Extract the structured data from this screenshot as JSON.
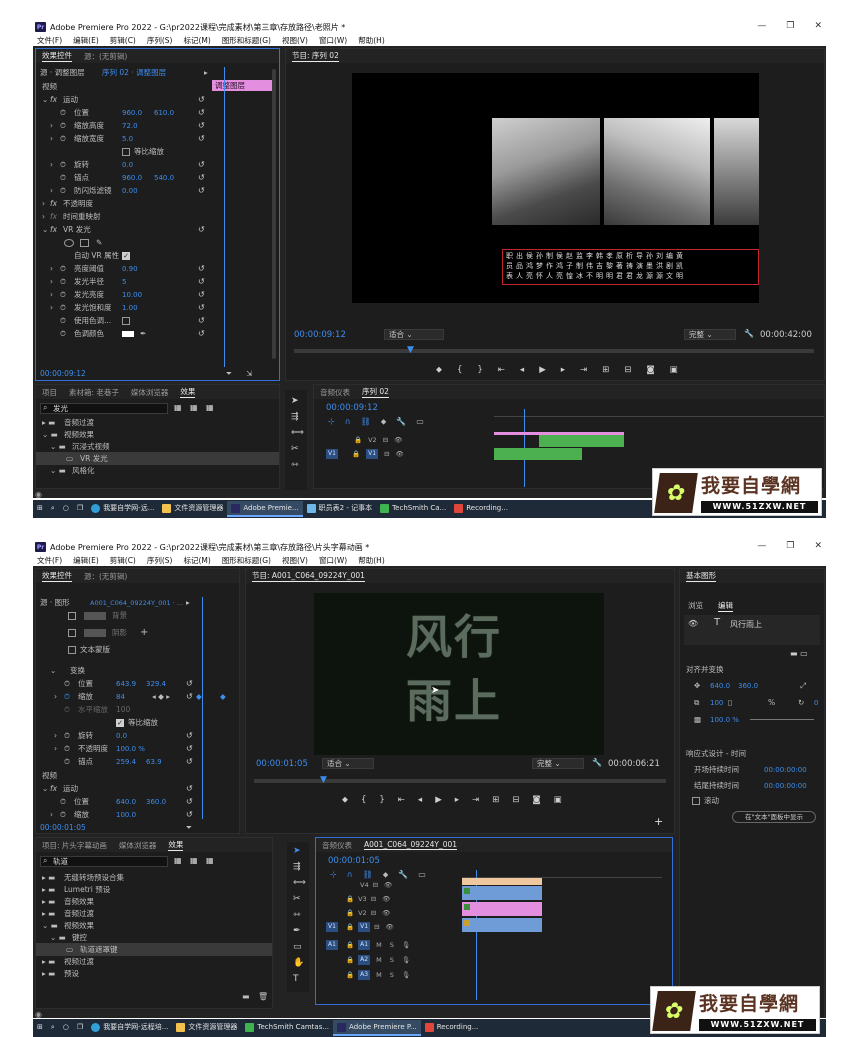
{
  "screen1": {
    "title": "Adobe Premiere Pro 2022 - G:\\pr2022课程\\完成素材\\第三章\\存放路径\\老照片 *",
    "menu": [
      "文件(F)",
      "编辑(E)",
      "剪辑(C)",
      "序列(S)",
      "标记(M)",
      "图形和标题(G)",
      "视图(V)",
      "窗口(W)",
      "帮助(H)"
    ],
    "effect_controls": {
      "tabs": [
        "效果控件",
        "源：(无剪辑)"
      ],
      "source_label": "源 · 调整图层",
      "sequence_label": "序列 02 · 调整图层",
      "clip_name": "调整图层",
      "section_video": "视频",
      "motion": "运动",
      "props": [
        {
          "name": "位置",
          "v1": "960.0",
          "v2": "610.0"
        },
        {
          "name": "缩放高度",
          "v1": "72.0",
          "v2": ""
        },
        {
          "name": "缩放宽度",
          "v1": "5.0",
          "v2": ""
        },
        {
          "name": "等比缩放",
          "v1": "",
          "v2": ""
        },
        {
          "name": "旋转",
          "v1": "0.0",
          "v2": ""
        },
        {
          "name": "锚点",
          "v1": "960.0",
          "v2": "540.0"
        },
        {
          "name": "防闪烁滤镜",
          "v1": "0.00",
          "v2": ""
        }
      ],
      "opacity": "不透明度",
      "time_remap": "时间重映射",
      "vr_glow": "VR 发光",
      "auto_vr": "自动 VR 属性",
      "glow_props": [
        {
          "name": "亮度阈值",
          "v": "0.90"
        },
        {
          "name": "发光半径",
          "v": "5"
        },
        {
          "name": "发光亮度",
          "v": "10.00"
        },
        {
          "name": "发光饱和度",
          "v": "1.00"
        },
        {
          "name": "使用色调...",
          "v": ""
        },
        {
          "name": "色调颜色",
          "v": ""
        }
      ],
      "timecode": "00:00:09:12"
    },
    "program": {
      "title": "节目: 序列 02",
      "timecode": "00:00:09:12",
      "fit": "适合",
      "quality": "完整",
      "duration": "00:00:42:00",
      "credits": [
        [
          "职",
          "员",
          "表"
        ],
        [
          "出",
          "品",
          "人"
        ],
        [
          "侯",
          "鸿",
          "亮"
        ],
        [
          "孙",
          "梦",
          "怀"
        ],
        [
          "制",
          "作",
          "人"
        ],
        [
          "侯",
          "鸿",
          "亮"
        ],
        [
          "赵",
          "子",
          "惶"
        ],
        [
          "监",
          "制",
          "冰"
        ],
        [
          "李",
          "伟",
          "不"
        ],
        [
          "韩",
          "吉",
          "明"
        ],
        [
          "孝",
          "黎",
          "明"
        ],
        [
          "原",
          "著",
          "君"
        ],
        [
          "析",
          "祷",
          "君"
        ],
        [
          "导",
          "演",
          "龙"
        ],
        [
          "孙",
          "墨",
          "源"
        ],
        [
          "刘",
          "洪",
          "源"
        ],
        [
          "编",
          "剧",
          "文"
        ],
        [
          "黄",
          "凯",
          "明"
        ]
      ]
    },
    "project": {
      "tabs": [
        "项目",
        "素材箱: 老巷子",
        "媒体浏览器",
        "效果"
      ],
      "search": "发光",
      "items": [
        "音频过渡",
        "视频效果",
        "沉浸式视频",
        "VR 发光",
        "风格化"
      ]
    },
    "timeline": {
      "tabs": [
        "音频仪表",
        "序列 02"
      ],
      "timecode": "00:00:09:12",
      "tracks": [
        "V2",
        "V1"
      ]
    },
    "taskbar": [
      "我要自学网-远...",
      "文件资源管理器",
      "Adobe Premie...",
      "职员表2 - 记事本",
      "TechSmith Ca...",
      "Recording..."
    ]
  },
  "screen2": {
    "title": "Adobe Premiere Pro 2022 - G:\\pr2022课程\\完成素材\\第三章\\存放路径\\片头字幕动画 *",
    "menu": [
      "文件(F)",
      "编辑(E)",
      "剪辑(C)",
      "序列(S)",
      "标记(M)",
      "图形和标题(G)",
      "视图(V)",
      "窗口(W)",
      "帮助(H)"
    ],
    "effect_controls": {
      "tabs": [
        "效果控件",
        "源：(无剪辑)"
      ],
      "source_label": "源 · 图形",
      "sequence_label": "A001_C064_09224Y_001 · ...",
      "rows": [
        {
          "name": "背景",
          "v1": "",
          "v2": ""
        },
        {
          "name": "阴影",
          "v1": "",
          "v2": ""
        },
        {
          "name": "文本蒙版",
          "v1": "",
          "v2": ""
        },
        {
          "name": "变换",
          "v1": "",
          "v2": ""
        },
        {
          "name": "位置",
          "v1": "643.9",
          "v2": "329.4"
        },
        {
          "name": "缩放",
          "v1": "84",
          "v2": ""
        },
        {
          "name": "水平缩放",
          "v1": "100",
          "v2": ""
        },
        {
          "name": "等比缩放",
          "v1": "",
          "v2": ""
        },
        {
          "name": "旋转",
          "v1": "0.0",
          "v2": ""
        },
        {
          "name": "不透明度",
          "v1": "100.0 %",
          "v2": ""
        },
        {
          "name": "锚点",
          "v1": "259.4",
          "v2": "63.9"
        }
      ],
      "section_video": "视频",
      "motion": "运动",
      "motion_props": [
        {
          "name": "位置",
          "v1": "640.0",
          "v2": "360.0"
        },
        {
          "name": "缩放",
          "v1": "100.0",
          "v2": ""
        }
      ],
      "timecode": "00:00:01:05"
    },
    "program": {
      "title": "节目: A001_C064_09224Y_001",
      "text_line1": "风行",
      "text_line2": "雨上",
      "timecode": "00:00:01:05",
      "fit": "适合",
      "quality": "完整",
      "duration": "00:00:06:21"
    },
    "essential_graphics": {
      "title": "基本图形",
      "tabs": [
        "浏览",
        "编辑"
      ],
      "layer": "风行雨上",
      "align": "对齐并变换",
      "pos_x": "640.0",
      "pos_y": "360.0",
      "scale": "100",
      "opacity": "100.0 %",
      "rotation": "0",
      "responsive": "响应式设计 - 时间",
      "start": "开场持续时间",
      "start_v": "00:00:00:00",
      "end": "结尾持续时间",
      "end_v": "00:00:00:00",
      "roll": "滚动",
      "show_btn": "在\"文本\"面板中显示"
    },
    "project": {
      "tabs": [
        "项目: 片头字幕动画",
        "媒体浏览器",
        "效果"
      ],
      "search": "轨道",
      "items": [
        "无缝转场预设合集",
        "Lumetri 预设",
        "音频效果",
        "音频过渡",
        "视频效果",
        "键控",
        "轨道遮罩键",
        "视频过渡",
        "预设"
      ]
    },
    "timeline": {
      "tabs": [
        "音频仪表",
        "A001_C064_09224Y_001"
      ],
      "timecode": "00:00:01:05",
      "tracks": [
        "V4",
        "V3",
        "V2",
        "V1",
        "A1",
        "A2",
        "A3"
      ]
    },
    "taskbar": [
      "我要自学网-远程培...",
      "文件资源管理器",
      "TechSmith Camtas...",
      "Adobe Premiere P...",
      "Recording..."
    ]
  },
  "watermark": {
    "title": "我要自學網",
    "url": "WWW.51ZXW.NET"
  },
  "colors": {
    "accent": "#3d8dee",
    "clip_green": "#4caf50",
    "clip_pink": "#e48ee0",
    "clip_blue": "#6f9bd6",
    "taskbar": "#1e2a38"
  }
}
